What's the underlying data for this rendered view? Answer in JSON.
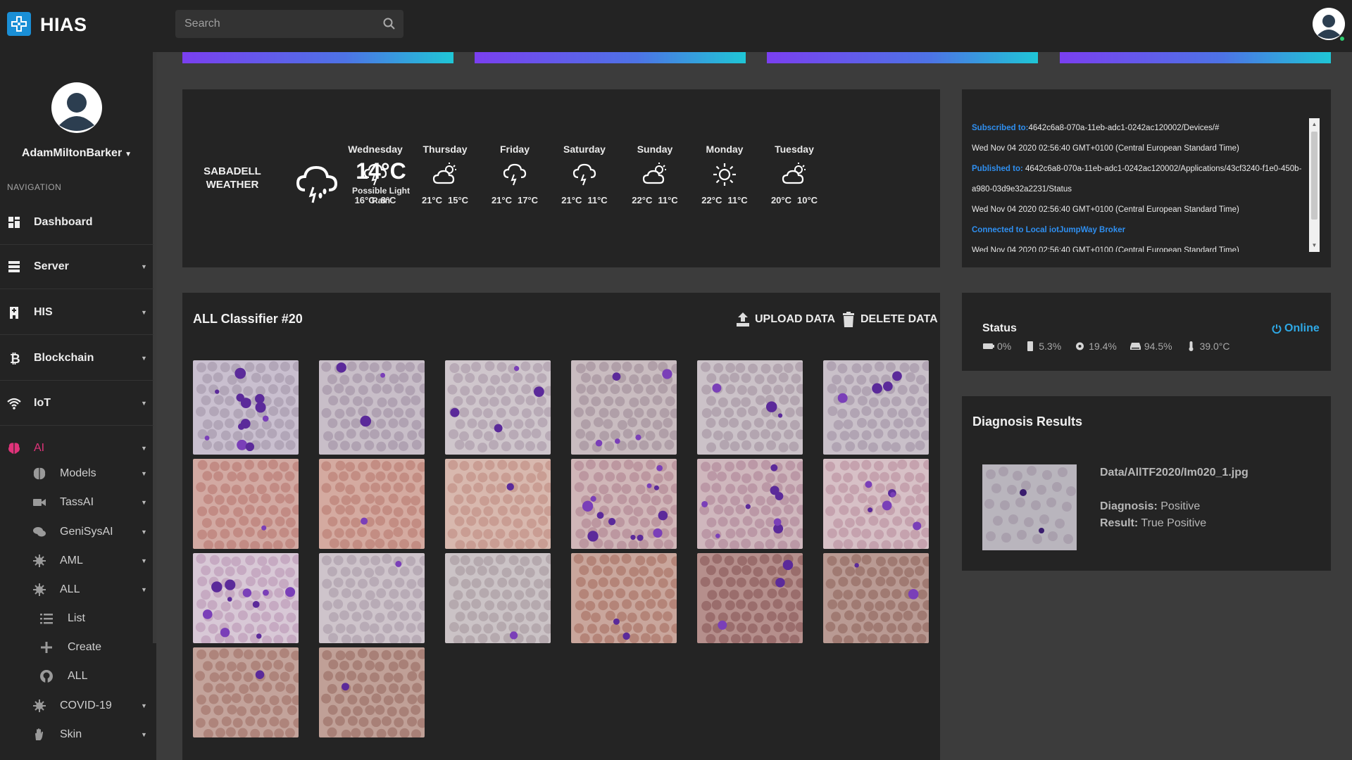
{
  "app": {
    "title": "HIAS"
  },
  "search": {
    "placeholder": "Search"
  },
  "sidebar": {
    "user": "AdamMiltonBarker",
    "section_title": "NAVIGATION",
    "items": [
      {
        "label": "Dashboard",
        "icon": "dashboard-icon"
      },
      {
        "label": "Server",
        "icon": "server-icon"
      },
      {
        "label": "HIS",
        "icon": "hospital-icon"
      },
      {
        "label": "Blockchain",
        "icon": "bitcoin-icon"
      },
      {
        "label": "IoT",
        "icon": "wifi-icon"
      },
      {
        "label": "AI",
        "icon": "brain-icon"
      }
    ],
    "ai_sub": [
      {
        "label": "Models",
        "icon": "models-icon"
      },
      {
        "label": "TassAI",
        "icon": "camera-icon"
      },
      {
        "label": "GeniSysAI",
        "icon": "chat-icon"
      },
      {
        "label": "AML",
        "icon": "virus-icon"
      },
      {
        "label": "ALL",
        "icon": "virus-icon"
      }
    ],
    "all_sub": [
      {
        "label": "List",
        "icon": "list-icon"
      },
      {
        "label": "Create",
        "icon": "plus-icon"
      },
      {
        "label": "ALL",
        "icon": "github-icon"
      }
    ],
    "bottom_sub": [
      {
        "label": "COVID-19",
        "icon": "covid-icon"
      },
      {
        "label": "Skin",
        "icon": "hand-icon"
      }
    ]
  },
  "weather": {
    "city": "SABADELL WEATHER",
    "temp": "14°C",
    "desc": "Possible Light Rain",
    "days": [
      {
        "name": "Wednesday",
        "high": "16°C",
        "low": "8°C",
        "icon": "rain-icon"
      },
      {
        "name": "Thursday",
        "high": "21°C",
        "low": "15°C",
        "icon": "partly-cloudy-icon"
      },
      {
        "name": "Friday",
        "high": "21°C",
        "low": "17°C",
        "icon": "rain-icon"
      },
      {
        "name": "Saturday",
        "high": "21°C",
        "low": "11°C",
        "icon": "rain-icon"
      },
      {
        "name": "Sunday",
        "high": "22°C",
        "low": "11°C",
        "icon": "partly-cloudy-icon"
      },
      {
        "name": "Monday",
        "high": "22°C",
        "low": "11°C",
        "icon": "sun-icon"
      },
      {
        "name": "Tuesday",
        "high": "20°C",
        "low": "10°C",
        "icon": "partly-cloudy-icon"
      }
    ]
  },
  "log": {
    "lines": [
      {
        "label": "Subscribed to:",
        "text": "4642c6a8-070a-11eb-adc1-0242ac120002/Devices/#"
      },
      {
        "label": "",
        "text": "Wed Nov 04 2020 02:56:40 GMT+0100 (Central European Standard Time)"
      },
      {
        "label": "Published to:",
        "text": " 4642c6a8-070a-11eb-adc1-0242ac120002/Applications/43cf3240-f1e0-450b-a980-03d9e32a2231/Status"
      },
      {
        "label": "",
        "text": "Wed Nov 04 2020 02:56:40 GMT+0100 (Central European Standard Time)"
      },
      {
        "label": "Connected to Local iotJumpWay Broker",
        "text": ""
      },
      {
        "label": "",
        "text": "Wed Nov 04 2020 02:56:40 GMT+0100 (Central European Standard Time)"
      }
    ]
  },
  "classifier": {
    "title": "ALL Classifier #20",
    "upload_label": "UPLOAD DATA",
    "delete_label": "DELETE DATA",
    "image_count": 20
  },
  "status": {
    "title": "Status",
    "online_label": "Online",
    "metrics": [
      {
        "icon": "battery-icon",
        "value": "0%"
      },
      {
        "icon": "memory-icon",
        "value": "5.3%"
      },
      {
        "icon": "cpu-icon",
        "value": "19.4%"
      },
      {
        "icon": "hdd-icon",
        "value": "94.5%"
      },
      {
        "icon": "thermometer-icon",
        "value": "39.0°C"
      }
    ]
  },
  "diagnosis": {
    "title": "Diagnosis Results",
    "file": "Data/AllTF2020/Im020_1.jpg",
    "diagnosis_label": "Diagnosis:",
    "diagnosis_value": "Positive",
    "result_label": "Result:",
    "result_value": "True Positive"
  },
  "colors": {
    "accent_pink": "#e0337a",
    "online_blue": "#2fa9e6",
    "log_blue": "#2f8ff0",
    "panel_bg": "#242424",
    "page_bg": "#3c3c3c"
  }
}
